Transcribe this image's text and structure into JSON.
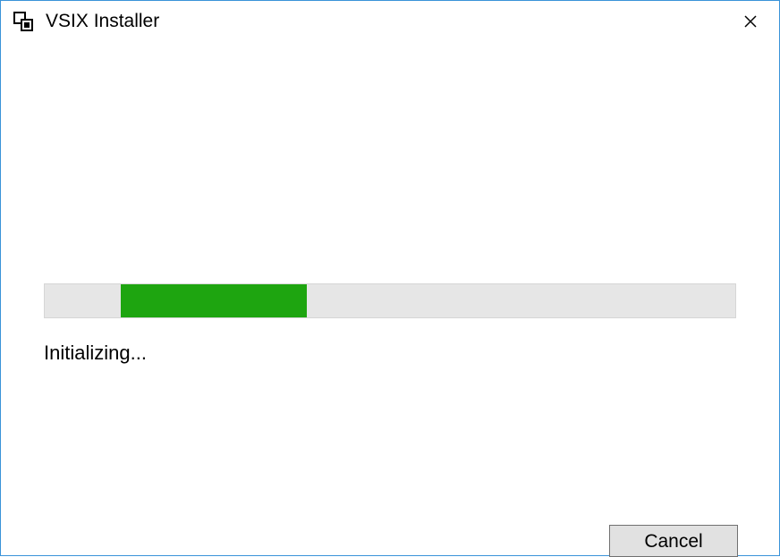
{
  "window": {
    "title": "VSIX Installer"
  },
  "progress": {
    "status_text": "Initializing...",
    "indeterminate": true,
    "block_left_percent": 11,
    "block_width_percent": 27,
    "fill_color": "#1ea510",
    "track_color": "#e6e6e6"
  },
  "buttons": {
    "cancel_label": "Cancel"
  }
}
